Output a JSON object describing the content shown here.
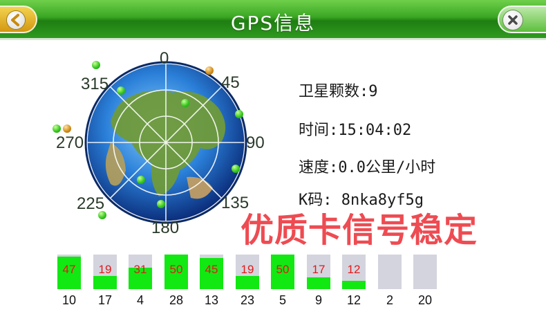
{
  "header": {
    "title": "GPS信息",
    "back_icon": "arrow-left-icon",
    "close_icon": "close-x-icon"
  },
  "compass": {
    "labels": [
      "0",
      "45",
      "90",
      "135",
      "180",
      "225",
      "270",
      "315"
    ]
  },
  "info": {
    "satellite_count": "卫星颗数:9",
    "time": "时间:15:04:02",
    "speed": "速度:0.0公里/小时",
    "k_code": "K码: 8nka8yf5g"
  },
  "watermark": "优质卡信号稳定",
  "signal_bars": [
    {
      "id": "10",
      "value": "47",
      "level": 47
    },
    {
      "id": "17",
      "value": "19",
      "level": 19
    },
    {
      "id": "4",
      "value": "31",
      "level": 31
    },
    {
      "id": "28",
      "value": "50",
      "level": 50
    },
    {
      "id": "13",
      "value": "45",
      "level": 45
    },
    {
      "id": "23",
      "value": "19",
      "level": 19
    },
    {
      "id": "5",
      "value": "50",
      "level": 50
    },
    {
      "id": "9",
      "value": "17",
      "level": 17
    },
    {
      "id": "12",
      "value": "12",
      "level": 12
    },
    {
      "id": "2",
      "value": "",
      "level": 0
    },
    {
      "id": "20",
      "value": "",
      "level": 0
    }
  ],
  "colors": {
    "header_green": "#2f9a1f",
    "bar_green": "#12e812",
    "bar_empty": "#d4d4de",
    "value_red": "#e11a1a",
    "watermark_red": "#ee4b52"
  }
}
